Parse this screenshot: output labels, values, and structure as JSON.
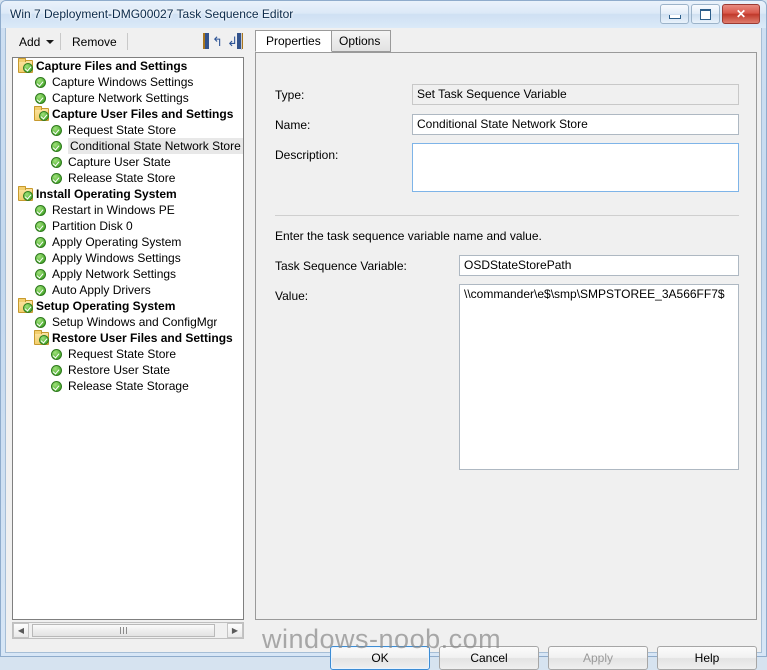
{
  "window": {
    "title": "Win 7 Deployment-DMG00027 Task Sequence Editor",
    "controls": {
      "minimize": "Minimize",
      "maximize": "Maximize",
      "close": "Close",
      "close_glyph": "✕"
    }
  },
  "toolbar": {
    "add_label": "Add",
    "remove_label": "Remove",
    "move_up_icon": "move-up-icon",
    "move_down_icon": "move-down-icon"
  },
  "tree": {
    "nodes": [
      {
        "label": "Capture Files and Settings",
        "indent": 0,
        "type": "group",
        "selected": false
      },
      {
        "label": "Capture Windows Settings",
        "indent": 1,
        "type": "step",
        "selected": false
      },
      {
        "label": "Capture Network Settings",
        "indent": 1,
        "type": "step",
        "selected": false
      },
      {
        "label": "Capture User Files and Settings",
        "indent": 1,
        "type": "group",
        "selected": false
      },
      {
        "label": "Request State Store",
        "indent": 2,
        "type": "step",
        "selected": false
      },
      {
        "label": "Conditional State Network Store",
        "indent": 2,
        "type": "step",
        "selected": true
      },
      {
        "label": "Capture User State",
        "indent": 2,
        "type": "step",
        "selected": false
      },
      {
        "label": "Release State Store",
        "indent": 2,
        "type": "step",
        "selected": false
      },
      {
        "label": "Install Operating System",
        "indent": 0,
        "type": "group",
        "selected": false
      },
      {
        "label": "Restart in Windows PE",
        "indent": 1,
        "type": "step",
        "selected": false
      },
      {
        "label": "Partition Disk 0",
        "indent": 1,
        "type": "step",
        "selected": false
      },
      {
        "label": "Apply Operating System",
        "indent": 1,
        "type": "step",
        "selected": false
      },
      {
        "label": "Apply Windows Settings",
        "indent": 1,
        "type": "step",
        "selected": false
      },
      {
        "label": "Apply Network Settings",
        "indent": 1,
        "type": "step",
        "selected": false
      },
      {
        "label": "Auto Apply Drivers",
        "indent": 1,
        "type": "step",
        "selected": false
      },
      {
        "label": "Setup Operating System",
        "indent": 0,
        "type": "group",
        "selected": false
      },
      {
        "label": "Setup Windows and ConfigMgr",
        "indent": 1,
        "type": "step",
        "selected": false
      },
      {
        "label": "Restore User Files and Settings",
        "indent": 1,
        "type": "group",
        "selected": false
      },
      {
        "label": "Request State Store",
        "indent": 2,
        "type": "step",
        "selected": false
      },
      {
        "label": "Restore User State",
        "indent": 2,
        "type": "step",
        "selected": false
      },
      {
        "label": "Release State Storage",
        "indent": 2,
        "type": "step",
        "selected": false
      }
    ],
    "hscroll": {
      "left_arrow": "◀",
      "right_arrow": "▶"
    }
  },
  "tabs": [
    {
      "label": "Properties",
      "active": true
    },
    {
      "label": "Options",
      "active": false
    }
  ],
  "properties": {
    "type_label": "Type:",
    "type_value": "Set Task Sequence Variable",
    "name_label": "Name:",
    "name_value": "Conditional State Network Store",
    "description_label": "Description:",
    "description_value": "",
    "description_placeholder": "",
    "hint": "Enter the task sequence variable name and value.",
    "variable_label": "Task Sequence Variable:",
    "variable_value": "OSDStateStorePath",
    "value_label": "Value:",
    "value_value": "\\\\commander\\e$\\smp\\SMPSTOREE_3A566FF7$"
  },
  "buttons": {
    "ok": "OK",
    "cancel": "Cancel",
    "apply": "Apply",
    "help": "Help"
  },
  "watermark": "windows-noob.com",
  "colors": {
    "accent": "#3c8cd4",
    "window_frame": "#cfe0f2",
    "dialog_bg": "#f0f0f0",
    "close_button": "#c0392b",
    "check_green": "#4fae32",
    "folder_yellow": "#f3cf6e",
    "selection": "#e8e8e8"
  }
}
